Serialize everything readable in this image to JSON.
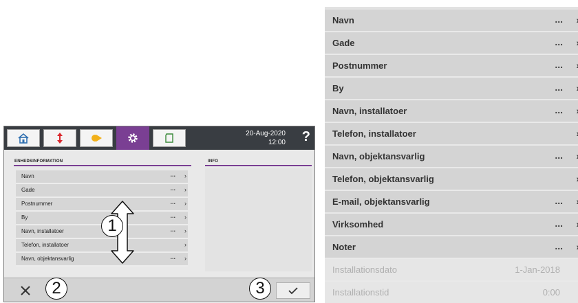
{
  "header": {
    "date": "20-Aug-2020",
    "time": "12:00",
    "help_label": "?",
    "tabs": [
      {
        "name": "home",
        "icon": "home-icon",
        "active": false
      },
      {
        "name": "refrigerant",
        "icon": "refrigerant-arrows-icon",
        "active": false
      },
      {
        "name": "defrost",
        "icon": "defrost-icon",
        "active": false
      },
      {
        "name": "settings",
        "icon": "gear-icon",
        "active": true
      },
      {
        "name": "documents",
        "icon": "document-icon",
        "active": false
      }
    ]
  },
  "sections": {
    "device_info": "ENHEDSINFORMATION",
    "info": "INFO"
  },
  "small_list": [
    {
      "label": "Navn",
      "dots": "...",
      "chevron": "›"
    },
    {
      "label": "Gade",
      "dots": "...",
      "chevron": "›"
    },
    {
      "label": "Postnummer",
      "dots": "...",
      "chevron": "›"
    },
    {
      "label": "By",
      "dots": "...",
      "chevron": "›"
    },
    {
      "label": "Navn, installatoer",
      "dots": "...",
      "chevron": "›"
    },
    {
      "label": "Telefon, installatoer",
      "dots": "",
      "chevron": "›"
    },
    {
      "label": "Navn, objektansvarlig",
      "dots": "...",
      "chevron": "›"
    }
  ],
  "footer": {
    "cancel_icon": "close-icon",
    "confirm_icon": "check-icon"
  },
  "callouts": [
    "1",
    "2",
    "3"
  ],
  "big_list": [
    {
      "label": "Navn",
      "dots": "...",
      "chevron": "›"
    },
    {
      "label": "Gade",
      "dots": "...",
      "chevron": "›"
    },
    {
      "label": "Postnummer",
      "dots": "...",
      "chevron": "›"
    },
    {
      "label": "By",
      "dots": "...",
      "chevron": "›"
    },
    {
      "label": "Navn, installatoer",
      "dots": "...",
      "chevron": "›"
    },
    {
      "label": "Telefon, installatoer",
      "dots": "",
      "chevron": "›"
    },
    {
      "label": "Navn, objektansvarlig",
      "dots": "...",
      "chevron": "›"
    },
    {
      "label": "Telefon, objektansvarlig",
      "dots": "",
      "chevron": "›"
    },
    {
      "label": "E-mail, objektansvarlig",
      "dots": "...",
      "chevron": "›"
    },
    {
      "label": "Virksomhed",
      "dots": "...",
      "chevron": "›"
    },
    {
      "label": "Noter",
      "dots": "...",
      "chevron": "›"
    },
    {
      "label": "Installationsdato",
      "value": "1-Jan-2018",
      "readonly": true
    },
    {
      "label": "Installationstid",
      "value": "0:00",
      "readonly": true
    }
  ],
  "colors": {
    "accent": "#7a3f93",
    "topbar": "#393d42",
    "row": "#d4d4d4"
  }
}
